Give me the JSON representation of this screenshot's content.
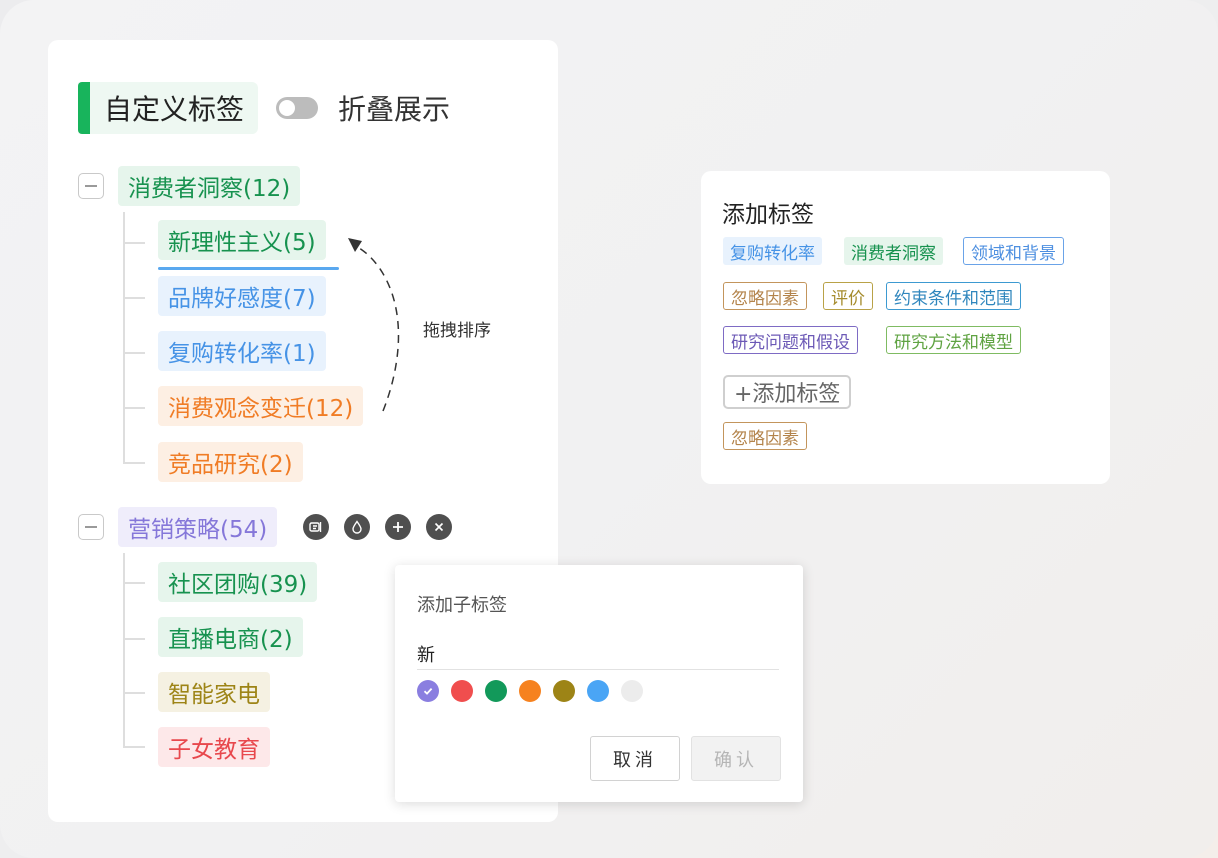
{
  "left_panel": {
    "title": "自定义标签",
    "toggle_label": "折叠展示",
    "toggle_on": false,
    "drag_hint": "拖拽排序",
    "groups": [
      {
        "label": "消费者洞察(12)",
        "color": "green",
        "children": [
          {
            "label": "新理性主义(5)",
            "color": "green"
          },
          {
            "label": "品牌好感度(7)",
            "color": "blue"
          },
          {
            "label": "复购转化率(1)",
            "color": "blue"
          },
          {
            "label": "消费观念变迁(12)",
            "color": "orange"
          },
          {
            "label": "竞品研究(2)",
            "color": "orange"
          }
        ]
      },
      {
        "label": "营销策略(54)",
        "color": "purple",
        "actions": [
          "edit-icon",
          "color-drop-icon",
          "plus-icon",
          "close-icon"
        ],
        "children": [
          {
            "label": "社区团购(39)",
            "color": "green"
          },
          {
            "label": "直播电商(2)",
            "color": "green"
          },
          {
            "label": "智能家电",
            "color": "olive"
          },
          {
            "label": "子女教育",
            "color": "red"
          }
        ]
      }
    ]
  },
  "add_tag_card": {
    "title": "添加标签",
    "chips": [
      {
        "label": "复购转化率",
        "style": "fill-blue"
      },
      {
        "label": "消费者洞察",
        "style": "fill-green"
      },
      {
        "label": "领域和背景",
        "style": "out-blue"
      },
      {
        "label": "忽略因素",
        "style": "out-tan"
      },
      {
        "label": "评价",
        "style": "out-olive"
      },
      {
        "label": "约束条件和范围",
        "style": "out-teal"
      },
      {
        "label": "研究问题和假设",
        "style": "out-purple"
      },
      {
        "label": "研究方法和模型",
        "style": "out-lime"
      }
    ],
    "add_button": "+添加标签",
    "extra_chip": "忽略因素"
  },
  "popup": {
    "title": "添加子标签",
    "input_value": "新",
    "colors": [
      "#8a7ee0",
      "#f04e4e",
      "#12995a",
      "#f6821f",
      "#9d8416",
      "#4aa5f5",
      "#ececec"
    ],
    "selected_color_index": 0,
    "cancel_label": "取消",
    "confirm_label": "确认"
  }
}
